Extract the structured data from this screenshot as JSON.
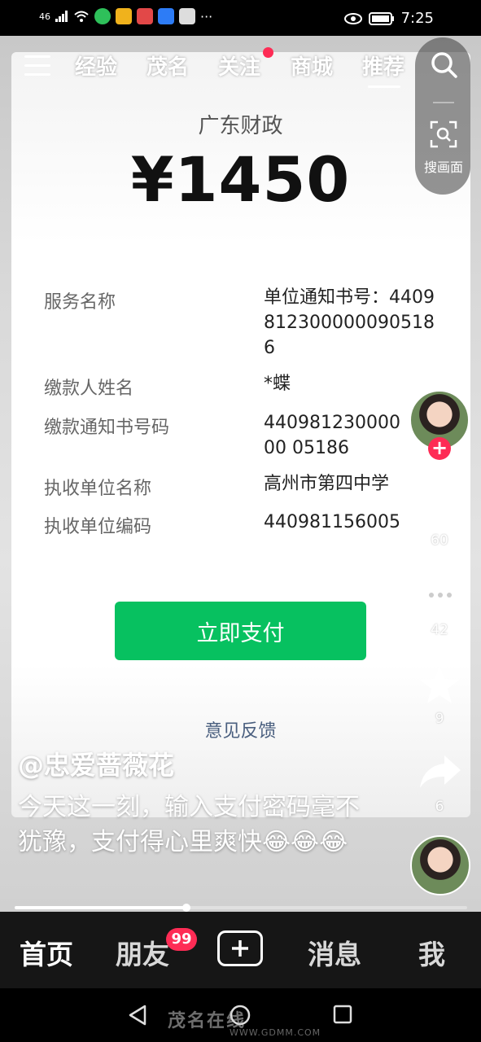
{
  "status_bar": {
    "signal_text": "46",
    "time": "7:25"
  },
  "top_nav": {
    "tabs": [
      {
        "label": "经验"
      },
      {
        "label": "茂名"
      },
      {
        "label": "关注"
      },
      {
        "label": "商城"
      },
      {
        "label": "推荐"
      }
    ],
    "active_tab": "推荐",
    "scan_label": "搜画面"
  },
  "payment": {
    "merchant": "广东财政",
    "amount": "¥1450",
    "fields": [
      {
        "label": "服务名称",
        "value": "单位通知书号：4409812300000090518 6"
      },
      {
        "label": "缴款人姓名",
        "value": "*蝶"
      },
      {
        "label": "缴款通知书号码",
        "value": "44098123000000 05186"
      },
      {
        "label": "执收单位名称",
        "value": "高州市第四中学"
      },
      {
        "label": "执收单位编码",
        "value": "440981156005"
      }
    ],
    "pay_button": "立即支付",
    "feedback": "意见反馈"
  },
  "rail": {
    "likes": "60",
    "comments": "42",
    "favorites": "9",
    "shares": "6",
    "follow_symbol": "+"
  },
  "post": {
    "author": "@忠爱蔷薇花",
    "caption": "今天这一刻，输入支付密码毫不犹豫，支付得心里爽快😂😂😂"
  },
  "progress": 0.38,
  "bottom_nav": {
    "home": "首页",
    "friends": "朋友",
    "friends_badge": "99",
    "messages": "消息",
    "me": "我"
  },
  "watermark": {
    "text": "茂名在线",
    "url": "WWW.GDMM.COM"
  },
  "colors": {
    "pay_green": "#07c160",
    "badge_red": "#fe2c55"
  }
}
